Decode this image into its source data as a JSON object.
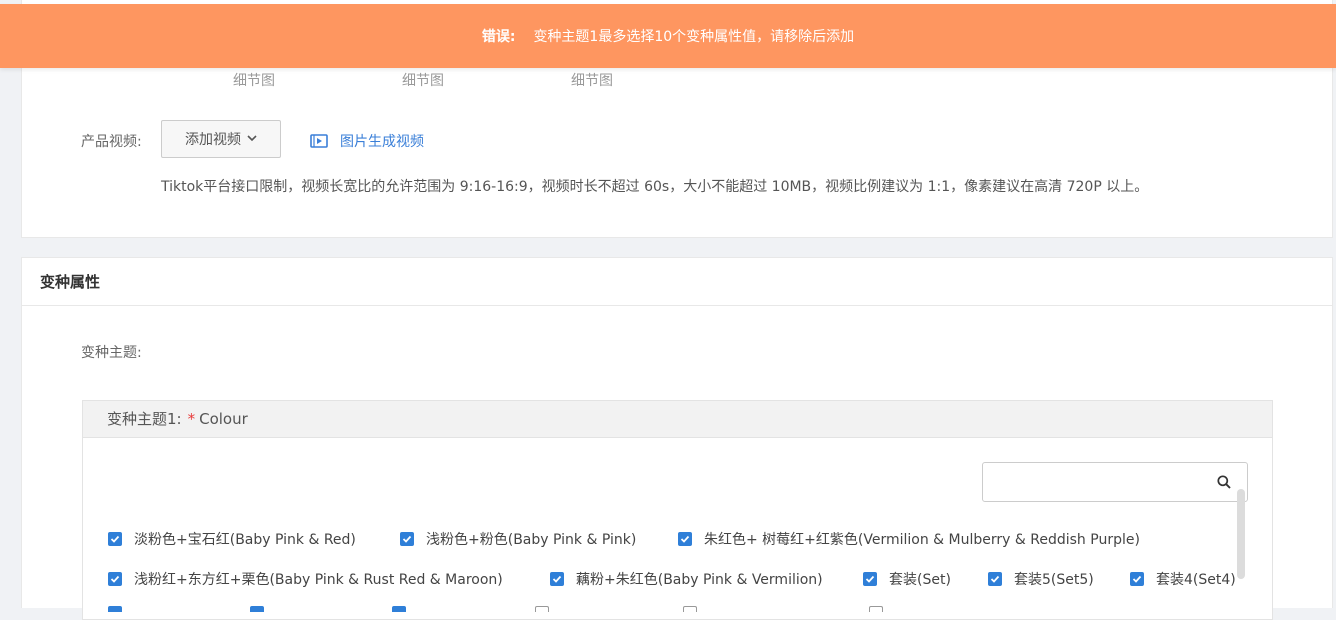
{
  "toast": {
    "label": "错误:",
    "message": "变种主题1最多选择10个变种属性值，请移除后添加",
    "color": "#fe9660"
  },
  "images": {
    "thumb_labels": [
      "细节图",
      "细节图",
      "细节图"
    ]
  },
  "video": {
    "label": "产品视频:",
    "add_button": "添加视频",
    "generate_link": "图片生成视频",
    "hint": "Tiktok平台接口限制，视频长宽比的允许范围为 9:16-16:9，视频时长不超过 60s，大小不能超过 10MB，视频比例建议为 1:1，像素建议在高清 720P 以上。"
  },
  "variant": {
    "section_title": "变种属性",
    "theme_label": "变种主题:",
    "theme1": {
      "label": "变种主题1:",
      "required_mark": "*",
      "name": "Colour"
    },
    "search": {
      "placeholder": "",
      "icon": "search-icon"
    },
    "options": [
      {
        "label": "淡粉色+宝石红(Baby Pink & Red)",
        "checked": true
      },
      {
        "label": "浅粉色+粉色(Baby Pink & Pink)",
        "checked": true
      },
      {
        "label": "朱红色+ 树莓红+红紫色(Vermilion & Mulberry & Reddish Purple)",
        "checked": true
      },
      {
        "label": "浅粉红+东方红+栗色(Baby Pink & Rust Red & Maroon)",
        "checked": true
      },
      {
        "label": "藕粉+朱红色(Baby Pink & Vermilion)",
        "checked": true
      },
      {
        "label": "套装(Set)",
        "checked": true
      },
      {
        "label": "套装5(Set5)",
        "checked": true
      },
      {
        "label": "套装4(Set4)",
        "checked": true
      }
    ],
    "accent_color": "#2f7fd8"
  }
}
